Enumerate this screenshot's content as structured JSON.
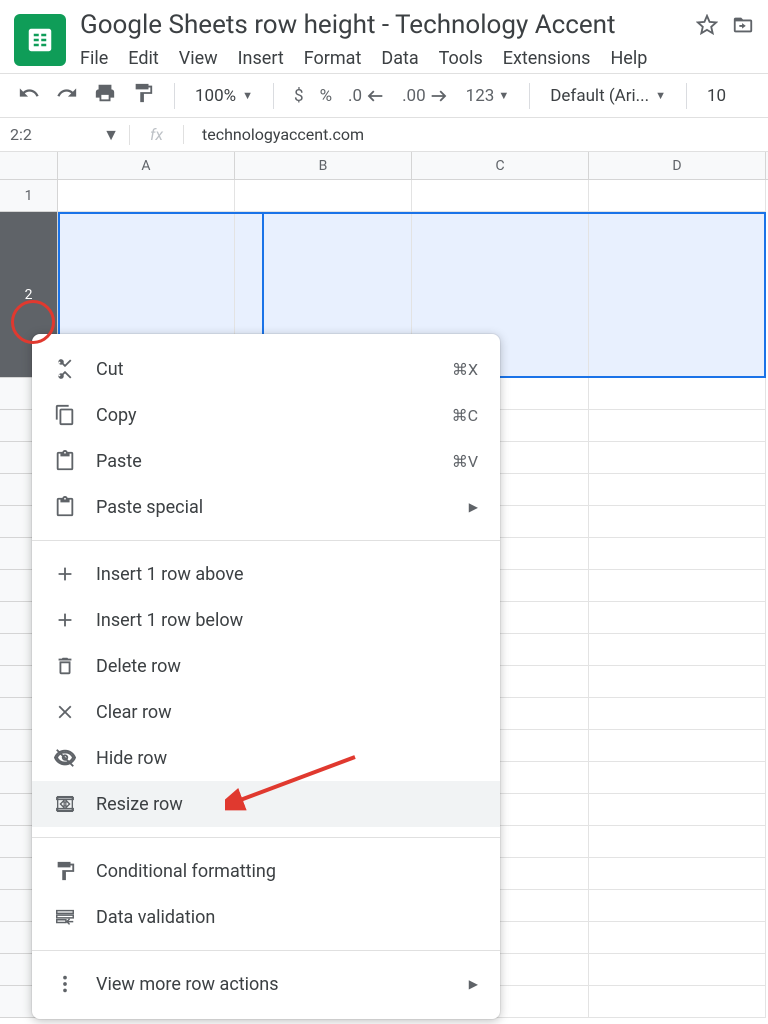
{
  "header": {
    "title": "Google Sheets row height - Technology Accent",
    "menus": [
      "File",
      "Edit",
      "View",
      "Insert",
      "Format",
      "Data",
      "Tools",
      "Extensions",
      "Help"
    ]
  },
  "toolbar": {
    "zoom": "100%",
    "dollar": "$",
    "percent": "%",
    "dec_dec": ".0",
    "dec_inc": ".00",
    "numfmt": "123",
    "font": "Default (Ari...",
    "fontsize": "10"
  },
  "formula": {
    "namebox": "2:2",
    "value": "technologyaccent.com"
  },
  "grid": {
    "cols": [
      "A",
      "B",
      "C",
      "D"
    ],
    "rows_before": [
      "1"
    ],
    "selected_row": "2"
  },
  "context_menu": {
    "cut": {
      "label": "Cut",
      "shortcut": "⌘X"
    },
    "copy": {
      "label": "Copy",
      "shortcut": "⌘C"
    },
    "paste": {
      "label": "Paste",
      "shortcut": "⌘V"
    },
    "paste_special": {
      "label": "Paste special"
    },
    "insert_above": {
      "label": "Insert 1 row above"
    },
    "insert_below": {
      "label": "Insert 1 row below"
    },
    "delete": {
      "label": "Delete row"
    },
    "clear": {
      "label": "Clear row"
    },
    "hide": {
      "label": "Hide row"
    },
    "resize": {
      "label": "Resize row"
    },
    "cond_format": {
      "label": "Conditional formatting"
    },
    "data_val": {
      "label": "Data validation"
    },
    "more": {
      "label": "View more row actions"
    }
  }
}
